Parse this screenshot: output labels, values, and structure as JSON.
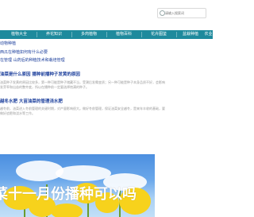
{
  "header": {
    "search_placeholder": "请输入搜索词"
  },
  "nav": {
    "items": [
      "植物大全",
      "养花知识",
      "多肉植物",
      "植物百科",
      "花卉图鉴",
      "盆栽种植",
      "农业"
    ]
  },
  "links": [
    "动物种植",
    "西瓜在种植如何有什么必要",
    "在管理 山药后的种植技术和栽培管理"
  ],
  "articles": [
    {
      "title": "油菜是什么原因 播种前播种子发黄的原因",
      "text": "油菜种子发黄的原因比较多，第一种可能是种子储藏不当，受潮后发霉变质；另一种可能是种子本身品质不好，会影响发芽率和出苗的整齐度，所以在播种前一定要选择饱满的种子。"
    },
    {
      "title": "越冬水肥 大苗油菜的管理浇水肥",
      "text": "越冬前，油菜进入冬前管理的关键时期，对产量影响很大。做好冬前管理，保证油菜安全越冬，是来年丰收的基础，要做好追肥和浇水等工作。"
    }
  ],
  "banner": {
    "caption": "菜十一月份播种可以吗"
  }
}
